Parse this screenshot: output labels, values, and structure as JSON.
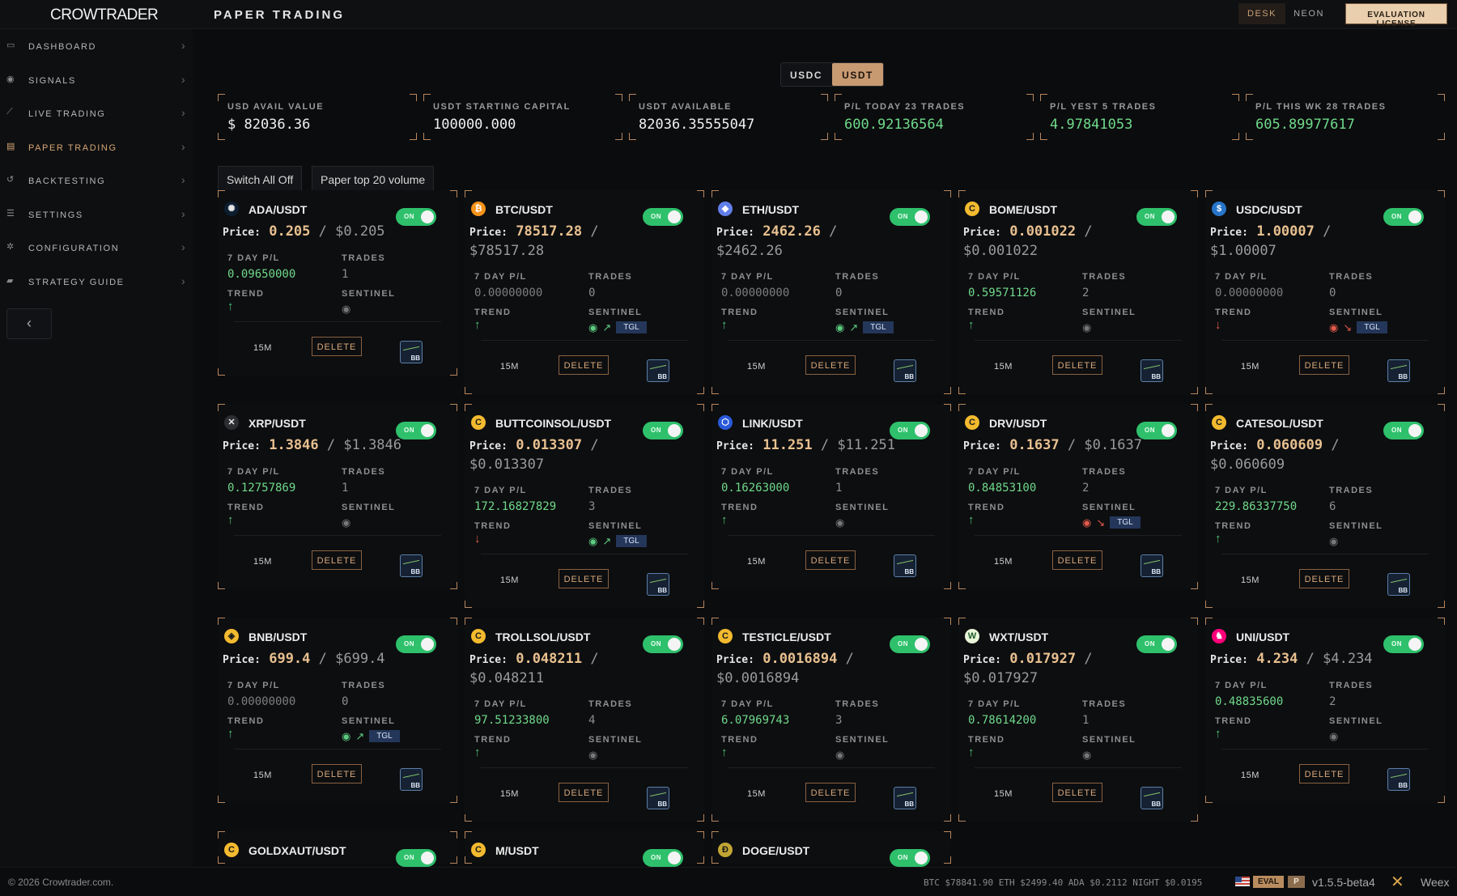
{
  "header": {
    "logo": "CROWTRADER",
    "title": "PAPER TRADING",
    "desk_label": "DESK",
    "neon_label": "NEON",
    "license_label": "EVALUATION LICENSE"
  },
  "sidebar": {
    "items": [
      {
        "label": "DASHBOARD",
        "icon": "monitor-icon"
      },
      {
        "label": "SIGNALS",
        "icon": "signal-icon"
      },
      {
        "label": "LIVE TRADING",
        "icon": "chart-line-icon"
      },
      {
        "label": "PAPER TRADING",
        "icon": "document-icon",
        "active": true
      },
      {
        "label": "BACKTESTING",
        "icon": "history-icon"
      },
      {
        "label": "SETTINGS",
        "icon": "sliders-icon"
      },
      {
        "label": "CONFIGURATION",
        "icon": "gear-icon"
      },
      {
        "label": "STRATEGY GUIDE",
        "icon": "book-icon"
      }
    ],
    "collapse_glyph": "‹"
  },
  "currency": {
    "options": [
      "USDC",
      "USDT"
    ],
    "selected": "USDT"
  },
  "stats": [
    {
      "label": "USD AVAIL VALUE",
      "value": "$ 82036.36",
      "green": false
    },
    {
      "label": "USDT STARTING CAPITAL",
      "value": "100000.000",
      "green": false
    },
    {
      "label": "USDT AVAILABLE",
      "value": "82036.35555047",
      "green": false
    },
    {
      "label": "P/L TODAY 23 TRADES",
      "value": "600.92136564",
      "green": true
    },
    {
      "label": "P/L YEST 5 TRADES",
      "value": "4.97841053",
      "green": true
    },
    {
      "label": "P/L THIS WK 28 TRADES",
      "value": "605.89977617",
      "green": true
    }
  ],
  "actions": {
    "switch_all_off": "Switch All Off",
    "paper_top20": "Paper top 20 volume"
  },
  "card_labels": {
    "price": "Price:",
    "pl7": "7 DAY P/L",
    "trades": "TRADES",
    "trend": "TREND",
    "sentinel": "SENTINEL",
    "toggle_on": "ON",
    "delete": "DELETE",
    "tgl": "TGL",
    "bb": "BB"
  },
  "cards": [
    {
      "pair": "ADA/USDT",
      "icon": "ada-icon",
      "icon_color": "#0d1e30",
      "icon_glyph": "✺",
      "price": "0.205",
      "usd": "$0.205",
      "pl": "0.09650000",
      "pl_green": true,
      "trades": "1",
      "trend": "up",
      "sentinel": "eye",
      "tf": "15M"
    },
    {
      "pair": "BTC/USDT",
      "icon": "btc-icon",
      "icon_color": "#f7931a",
      "icon_glyph": "₿",
      "price": "78517.28",
      "usd": "$78517.28",
      "pl": "0.00000000",
      "pl_green": false,
      "trades": "0",
      "trend": "up",
      "sentinel": "green-tgl",
      "tf": "15M"
    },
    {
      "pair": "ETH/USDT",
      "icon": "eth-icon",
      "icon_color": "#627eea",
      "icon_glyph": "◆",
      "price": "2462.26",
      "usd": "$2462.26",
      "pl": "0.00000000",
      "pl_green": false,
      "trades": "0",
      "trend": "up",
      "sentinel": "green-tgl",
      "tf": "15M"
    },
    {
      "pair": "BOME/USDT",
      "icon": "bome-icon",
      "icon_color": "#f3ba2f",
      "icon_glyph": "C",
      "price": "0.001022",
      "usd": "$0.001022",
      "pl": "0.59571126",
      "pl_green": true,
      "trades": "2",
      "trend": "up",
      "sentinel": "eye",
      "tf": "15M"
    },
    {
      "pair": "USDC/USDT",
      "icon": "usdc-icon",
      "icon_color": "#2775ca",
      "icon_glyph": "$",
      "price": "1.00007",
      "usd": "$1.00007",
      "pl": "0.00000000",
      "pl_green": false,
      "trades": "0",
      "trend": "down",
      "sentinel": "red-tgl",
      "tf": "15M"
    },
    {
      "pair": "XRP/USDT",
      "icon": "xrp-icon",
      "icon_color": "#2b2d31",
      "icon_glyph": "✕",
      "price": "1.3846",
      "usd": "$1.3846",
      "pl": "0.12757869",
      "pl_green": true,
      "trades": "1",
      "trend": "up",
      "sentinel": "eye",
      "tf": "15M"
    },
    {
      "pair": "BUTTCOINSOL/USDT",
      "icon": "buttcoin-icon",
      "icon_color": "#f3ba2f",
      "icon_glyph": "C",
      "price": "0.013307",
      "usd": "$0.013307",
      "pl": "172.16827829",
      "pl_green": true,
      "trades": "3",
      "trend": "down",
      "sentinel": "green-tgl",
      "tf": "15M"
    },
    {
      "pair": "LINK/USDT",
      "icon": "link-icon",
      "icon_color": "#2a5ada",
      "icon_glyph": "⬡",
      "price": "11.251",
      "usd": "$11.251",
      "pl": "0.16263000",
      "pl_green": true,
      "trades": "1",
      "trend": "up",
      "sentinel": "eye",
      "tf": "15M"
    },
    {
      "pair": "DRV/USDT",
      "icon": "drv-icon",
      "icon_color": "#f3ba2f",
      "icon_glyph": "C",
      "price": "0.1637",
      "usd": "$0.1637",
      "pl": "0.84853100",
      "pl_green": true,
      "trades": "2",
      "trend": "up",
      "sentinel": "red-tgl",
      "tf": "15M"
    },
    {
      "pair": "CATESOL/USDT",
      "icon": "catesol-icon",
      "icon_color": "#f3ba2f",
      "icon_glyph": "C",
      "price": "0.060609",
      "usd": "$0.060609",
      "pl": "229.86337750",
      "pl_green": true,
      "trades": "6",
      "trend": "up",
      "sentinel": "eye",
      "tf": "15M"
    },
    {
      "pair": "BNB/USDT",
      "icon": "bnb-icon",
      "icon_color": "#f3ba2f",
      "icon_glyph": "◈",
      "price": "699.4",
      "usd": "$699.4",
      "pl": "0.00000000",
      "pl_green": false,
      "trades": "0",
      "trend": "up",
      "sentinel": "green-tgl",
      "tf": "15M"
    },
    {
      "pair": "TROLLSOL/USDT",
      "icon": "trollsol-icon",
      "icon_color": "#f3ba2f",
      "icon_glyph": "C",
      "price": "0.048211",
      "usd": "$0.048211",
      "pl": "97.51233800",
      "pl_green": true,
      "trades": "4",
      "trend": "up",
      "sentinel": "eye",
      "tf": "15M"
    },
    {
      "pair": "TESTICLE/USDT",
      "icon": "testicle-icon",
      "icon_color": "#f3ba2f",
      "icon_glyph": "C",
      "price": "0.0016894",
      "usd": "$0.0016894",
      "pl": "6.07969743",
      "pl_green": true,
      "trades": "3",
      "trend": "up",
      "sentinel": "eye",
      "tf": "15M"
    },
    {
      "pair": "WXT/USDT",
      "icon": "wxt-icon",
      "icon_color": "#e8f5d8",
      "icon_glyph": "W",
      "price": "0.017927",
      "usd": "$0.017927",
      "pl": "0.78614200",
      "pl_green": true,
      "trades": "1",
      "trend": "up",
      "sentinel": "eye",
      "tf": "15M"
    },
    {
      "pair": "UNI/USDT",
      "icon": "uni-icon",
      "icon_color": "#ff007a",
      "icon_glyph": "♞",
      "price": "4.234",
      "usd": "$4.234",
      "pl": "0.48835600",
      "pl_green": true,
      "trades": "2",
      "trend": "up",
      "sentinel": "eye",
      "tf": "15M"
    },
    {
      "pair": "GOLDXAUT/USDT",
      "icon": "goldxaut-icon",
      "icon_color": "#f3ba2f",
      "icon_glyph": "C"
    },
    {
      "pair": "M/USDT",
      "icon": "m-icon",
      "icon_color": "#f3ba2f",
      "icon_glyph": "C"
    },
    {
      "pair": "DOGE/USDT",
      "icon": "doge-icon",
      "icon_color": "#c2a633",
      "icon_glyph": "Ð"
    }
  ],
  "footer": {
    "copyright": "© 2026 Crowtrader.com.",
    "tickers": "BTC $78841.90   ETH $2499.40   ADA $0.2112   NIGHT $0.0195",
    "eval_badge": "EVAL",
    "p_badge": "P",
    "version": "v1.5.5-beta4",
    "user": "Weex"
  }
}
